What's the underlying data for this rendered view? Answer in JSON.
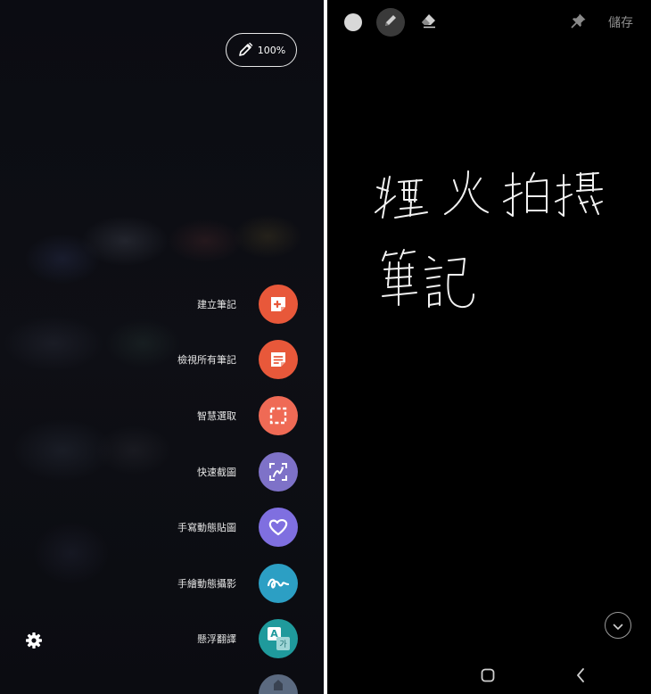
{
  "air_command": {
    "zoom_level": "100%",
    "items": [
      {
        "label": "建立筆記",
        "icon": "create-note-icon",
        "color": "#e8583a"
      },
      {
        "label": "檢視所有筆記",
        "icon": "view-all-notes-icon",
        "color": "#e8583a"
      },
      {
        "label": "智慧選取",
        "icon": "smart-select-icon",
        "color": "#ef6a55"
      },
      {
        "label": "快速截圖",
        "icon": "screen-write-icon",
        "color": "#7e72c8"
      },
      {
        "label": "手寫動態貼圖",
        "icon": "live-message-icon",
        "color": "#7f6fe0"
      },
      {
        "label": "手繪動態攝影",
        "icon": "ar-doodle-icon",
        "color": "#2c9fc4"
      },
      {
        "label": "懸浮翻譯",
        "icon": "translate-icon",
        "color": "#1f9a9c"
      }
    ],
    "translate_glyphs": {
      "a": "A",
      "b": "가"
    }
  },
  "note": {
    "save_label": "儲存",
    "handwriting_lines": [
      "煙火拍攝",
      "筆記"
    ]
  },
  "colors": {
    "background": "#000000",
    "divider": "#ffffff",
    "save_text": "#8e8e8e"
  }
}
